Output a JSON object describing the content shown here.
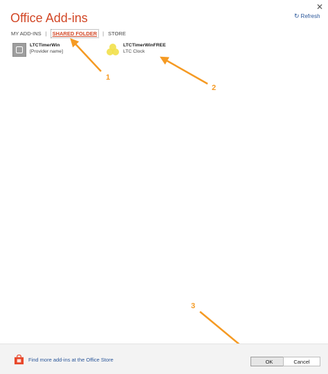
{
  "dialog": {
    "title": "Office Add-ins",
    "close_glyph": "✕",
    "refresh_label": "Refresh"
  },
  "tabs": [
    {
      "label": "MY ADD-INS",
      "active": false
    },
    {
      "label": "SHARED FOLDER",
      "active": true
    },
    {
      "label": "STORE",
      "active": false
    }
  ],
  "addins": [
    {
      "name": "LTCTimerWin",
      "subtitle": "[Provider name]",
      "icon": "generic-addin-icon"
    },
    {
      "name": "LTCTimerWinFREE",
      "subtitle": "LTC Clock",
      "icon": "yellow-circles-icon"
    }
  ],
  "callouts": {
    "one": "1",
    "two": "2",
    "three": "3"
  },
  "footer": {
    "store_link": "Find more add-ins at the Office Store",
    "ok_label": "OK",
    "cancel_label": "Cancel"
  },
  "colors": {
    "accent": "#d24726",
    "link": "#2b579a",
    "arrow": "#f59a23"
  }
}
